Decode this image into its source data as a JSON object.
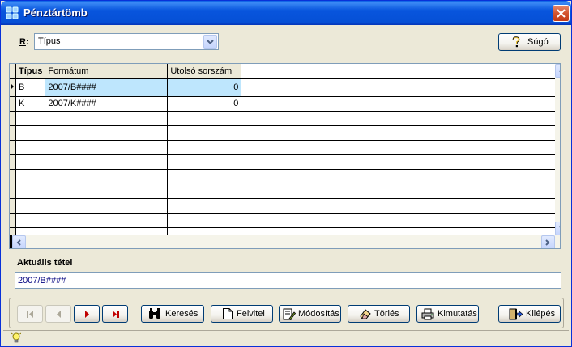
{
  "window": {
    "title": "Pénztártömb",
    "close_icon": "close-icon"
  },
  "filter": {
    "label_mnemonic": "R",
    "label_rest": ":",
    "value": "Típus"
  },
  "help_button": {
    "label": "Súgó",
    "icon": "question-mark-icon"
  },
  "grid": {
    "columns": [
      "Típus",
      "Formátum",
      "Utolsó sorszám"
    ],
    "rows": [
      {
        "type": "B",
        "format": "2007/B####",
        "last": "0"
      },
      {
        "type": "K",
        "format": "2007/K####",
        "last": "0"
      }
    ],
    "selected_row": 0
  },
  "current": {
    "label": "Aktuális tétel",
    "value": "2007/B####"
  },
  "toolbar": {
    "search": "Keresés",
    "add": "Felvitel",
    "edit": "Módosítás",
    "delete": "Törlés",
    "report": "Kimutatás",
    "exit": "Kilépés"
  },
  "colors": {
    "title_bar": "#0855dd",
    "selection": "#bee6fd",
    "accent": "#00007f"
  }
}
